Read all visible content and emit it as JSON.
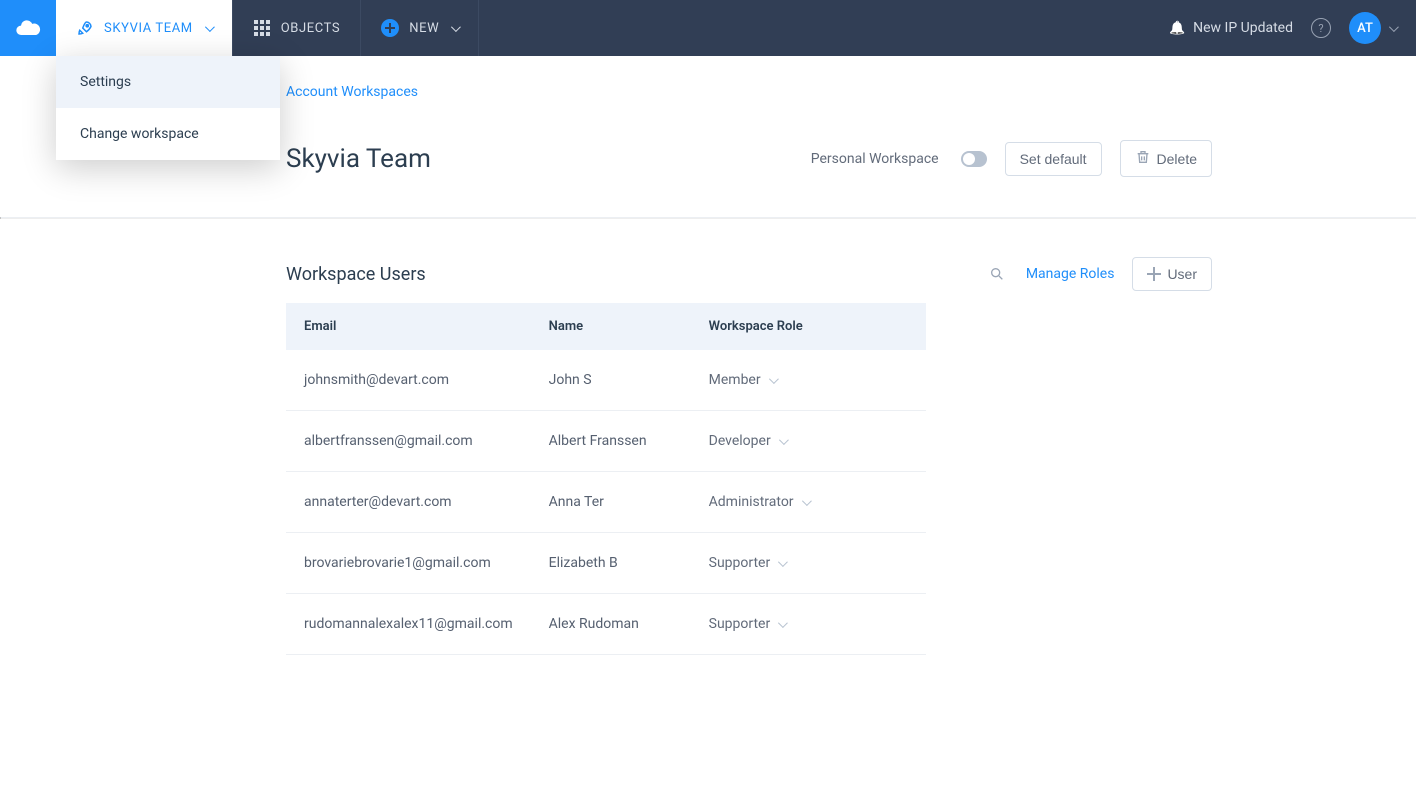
{
  "topbar": {
    "team_label": "SKYVIA TEAM",
    "objects_label": "OBJECTS",
    "new_label": "NEW",
    "dropdown": {
      "settings": "Settings",
      "change_workspace": "Change workspace"
    }
  },
  "topright": {
    "notification": "New IP Updated",
    "avatar_initials": "AT"
  },
  "breadcrumb": {
    "text": "Account Workspaces"
  },
  "header": {
    "title": "Skyvia Team",
    "personal_workspace_label": "Personal Workspace",
    "set_default": "Set default",
    "delete": "Delete"
  },
  "users_section": {
    "title": "Workspace Users",
    "manage_roles": "Manage Roles",
    "add_user": "User",
    "columns": {
      "email": "Email",
      "name": "Name",
      "role": "Workspace Role"
    },
    "rows": [
      {
        "email": "johnsmith@devart.com",
        "name": "John S",
        "role": "Member"
      },
      {
        "email": "albertfranssen@gmail.com",
        "name": "Albert Franssen",
        "role": "Developer"
      },
      {
        "email": "annaterter@devart.com",
        "name": "Anna Ter",
        "role": "Administrator"
      },
      {
        "email": "brovariebrovarie1@gmail.com",
        "name": "Elizabeth B",
        "role": "Supporter"
      },
      {
        "email": "rudomannalexalex11@gmail.com",
        "name": "Alex Rudoman",
        "role": "Supporter"
      }
    ]
  }
}
